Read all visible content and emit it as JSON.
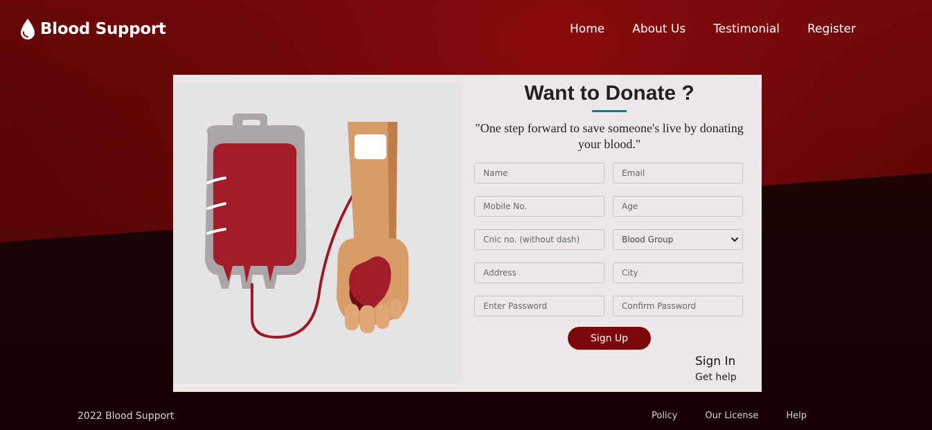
{
  "brand": {
    "name": "Blood Support",
    "icon": "blood-drop-icon"
  },
  "nav": {
    "items": [
      "Home",
      "About Us",
      "Testimonial",
      "Register"
    ]
  },
  "form": {
    "title": "Want to Donate ?",
    "quote": "\"One step forward to save someone's live by donating your blood.\"",
    "fields": {
      "name": "Name",
      "email": "Email",
      "mobile": "Mobile No.",
      "age": "Age",
      "cnic": "Cnic no. (without dash)",
      "blood_group": "Blood Group",
      "address": "Address",
      "city": "City",
      "password": "Enter Password",
      "confirm_password": "Confirm Password"
    },
    "signup_label": "Sign Up",
    "signin_label": "Sign In",
    "help_label": "Get help"
  },
  "footer": {
    "copyright": "2022 Blood Support",
    "links": [
      "Policy",
      "Our License",
      "Help"
    ]
  },
  "colors": {
    "accent": "#7d0608",
    "underline": "#117a7f",
    "card": "#ede8e8"
  }
}
